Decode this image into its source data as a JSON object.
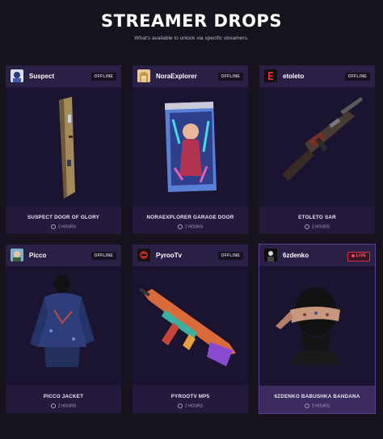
{
  "header": {
    "title": "STREAMER DROPS",
    "subtitle": "What's available to unlock via specific streamers."
  },
  "cards": [
    {
      "streamer": "Suspect",
      "status": "OFFLINE",
      "item": "SUSPECT DOOR OF GLORY",
      "duration": "2 HOURS",
      "icon": "door-icon"
    },
    {
      "streamer": "NoraExplorer",
      "status": "OFFLINE",
      "item": "NORAEXPLORER GARAGE DOOR",
      "duration": "2 HOURS",
      "icon": "garage-door-icon"
    },
    {
      "streamer": "etoleto",
      "status": "OFFLINE",
      "item": "ETOLETO SAR",
      "duration": "2 HOURS",
      "icon": "rifle-icon"
    },
    {
      "streamer": "Picco",
      "status": "OFFLINE",
      "item": "PICCO JACKET",
      "duration": "2 HOURS",
      "icon": "jacket-icon"
    },
    {
      "streamer": "PyrooTv",
      "status": "OFFLINE",
      "item": "PYROOTV MP5",
      "duration": "2 HOURS",
      "icon": "smg-icon"
    },
    {
      "streamer": "6zdenko",
      "status": "LIVE",
      "item": "6ZDENKO BABUSHKA BANDANA",
      "duration": "2 HOURS",
      "icon": "bandana-icon"
    }
  ],
  "colors": {
    "background": "#16131f",
    "card": "#1f1733",
    "card_header": "#2a1f44",
    "live_accent": "#d33a52"
  }
}
